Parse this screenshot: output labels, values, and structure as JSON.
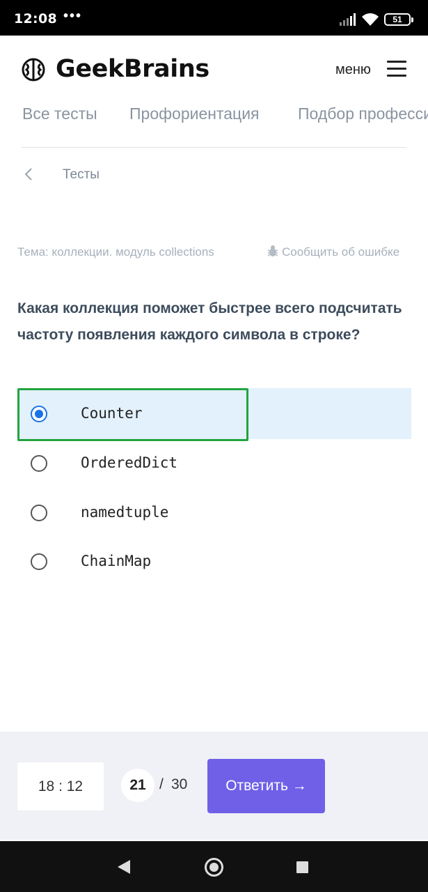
{
  "status_bar": {
    "time": "12:08",
    "dots": "•••",
    "battery": "51",
    "icons": [
      "signal-icon",
      "wifi-icon",
      "battery-icon"
    ]
  },
  "header": {
    "brand": "GeekBrains",
    "menu_label": "меню",
    "icons": [
      "brain-logo-icon",
      "hamburger-menu-icon"
    ]
  },
  "tabs": [
    {
      "label": "Все тесты"
    },
    {
      "label": "Профориентация"
    },
    {
      "label": "Подбор профессии"
    }
  ],
  "breadcrumb": {
    "label": "Тесты",
    "icon": "chevron-left-icon"
  },
  "topic": {
    "text": "Тема: коллекции. модуль collections",
    "report_label": "Сообщить об ошибке",
    "report_icon": "bug-icon"
  },
  "question": {
    "text": "Какая коллекция поможет быстрее всего подсчитать частоту появления каждого символа в строке?"
  },
  "options": [
    {
      "label": "Counter",
      "selected": true
    },
    {
      "label": "OrderedDict",
      "selected": false
    },
    {
      "label": "namedtuple",
      "selected": false
    },
    {
      "label": "ChainMap",
      "selected": false
    }
  ],
  "footer": {
    "timer": "18 : 12",
    "current_question": "21",
    "separator": "/",
    "total_questions": "30",
    "answer_button": "Ответить →"
  },
  "nav_bar": {
    "icons": [
      "back-triangle-icon",
      "home-circle-icon",
      "recent-apps-square-icon"
    ]
  },
  "colors": {
    "accent": "#7060e8",
    "selected_bg": "#e3f1fc",
    "radio_checked": "#1a73e8",
    "highlight_border": "#22a33f"
  }
}
